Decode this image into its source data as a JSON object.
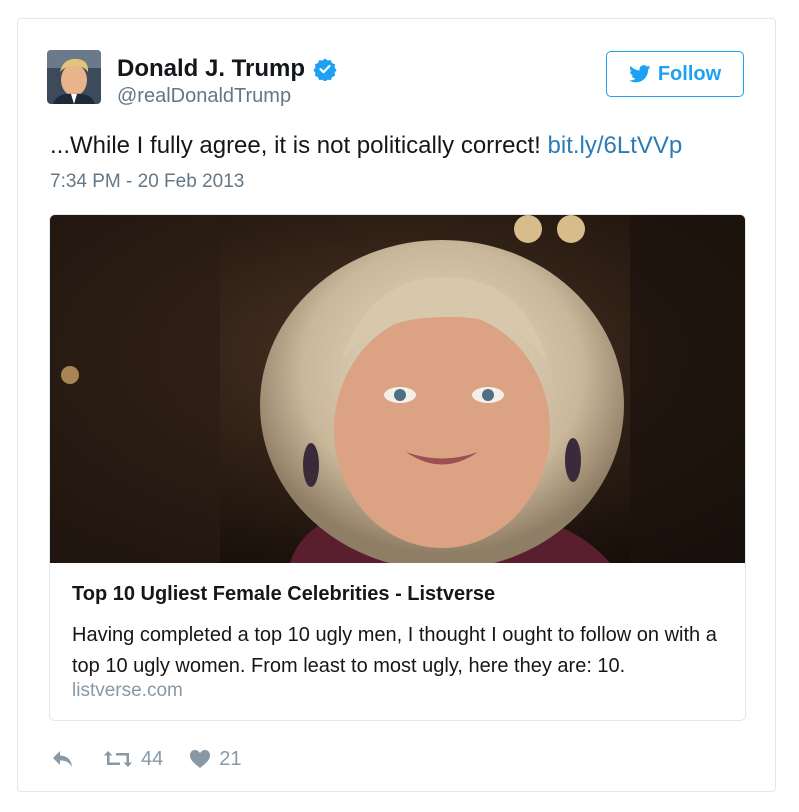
{
  "author": {
    "name": "Donald J. Trump",
    "handle": "@realDonaldTrump",
    "verified": true
  },
  "follow_button": {
    "label": "Follow",
    "icon": "twitter-bird-icon"
  },
  "tweet": {
    "text": "...While I fully agree, it is not politically correct! ",
    "link": "bit.ly/6LtVVp",
    "timestamp": "7:34 PM - 20 Feb 2013"
  },
  "card": {
    "title": "Top 10 Ugliest Female Celebrities - Listverse",
    "description": "Having completed a top 10 ugly men, I thought I ought to follow on with a top 10 ugly women. From least to most ugly, here they are: 10.",
    "domain": "listverse.com"
  },
  "actions": {
    "reply_icon": "reply-icon",
    "retweet_count": "44",
    "like_count": "21"
  },
  "colors": {
    "accent": "#1da1f2",
    "link": "#2b7bb9",
    "secondary_text": "#657786",
    "border": "#e1e8ed"
  }
}
